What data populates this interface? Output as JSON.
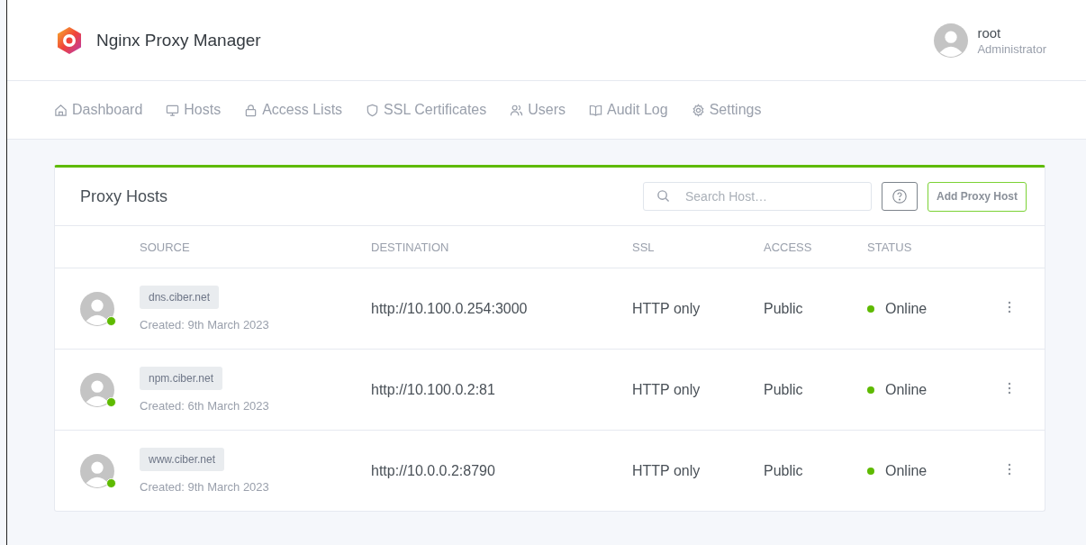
{
  "app": {
    "title": "Nginx Proxy Manager"
  },
  "user": {
    "name": "root",
    "role": "Administrator"
  },
  "nav": [
    {
      "label": "Dashboard"
    },
    {
      "label": "Hosts"
    },
    {
      "label": "Access Lists"
    },
    {
      "label": "SSL Certificates"
    },
    {
      "label": "Users"
    },
    {
      "label": "Audit Log"
    },
    {
      "label": "Settings"
    }
  ],
  "card": {
    "title": "Proxy Hosts",
    "search": {
      "placeholder": "Search Host…"
    },
    "add_button": "Add Proxy Host"
  },
  "table": {
    "columns": [
      "SOURCE",
      "DESTINATION",
      "SSL",
      "ACCESS",
      "STATUS"
    ],
    "rows": [
      {
        "source": "dns.ciber.net",
        "created": "Created: 9th March 2023",
        "destination": "http://10.100.0.254:3000",
        "ssl": "HTTP only",
        "access": "Public",
        "status": "Online",
        "online": true
      },
      {
        "source": "npm.ciber.net",
        "created": "Created: 6th March 2023",
        "destination": "http://10.100.0.2:81",
        "ssl": "HTTP only",
        "access": "Public",
        "status": "Online",
        "online": true
      },
      {
        "source": "www.ciber.net",
        "created": "Created: 9th March 2023",
        "destination": "http://10.0.0.2:8790",
        "ssl": "HTTP only",
        "access": "Public",
        "status": "Online",
        "online": true
      }
    ]
  }
}
